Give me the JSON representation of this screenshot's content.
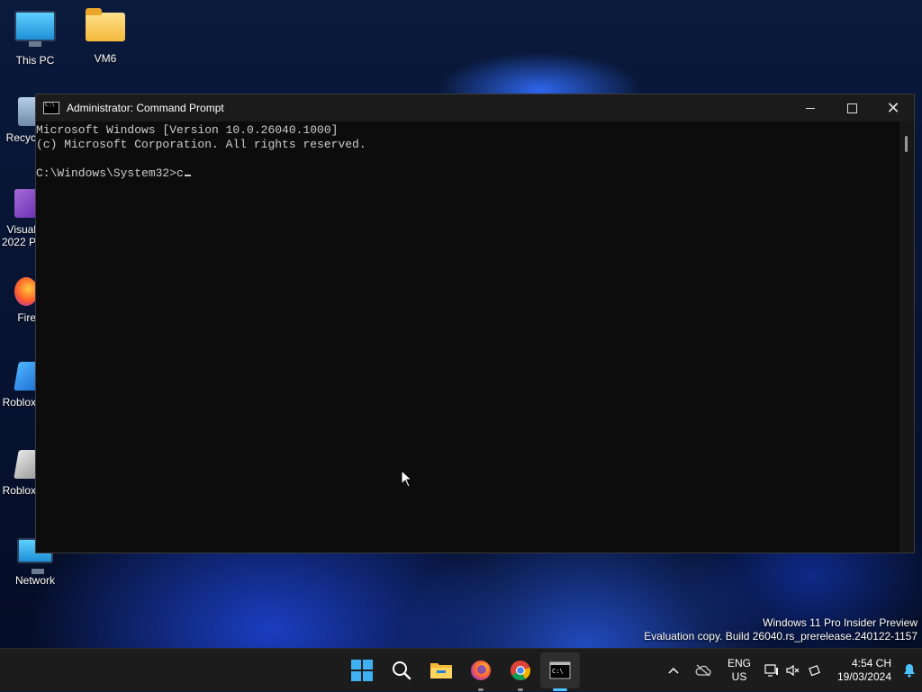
{
  "desktop": {
    "icons": [
      {
        "name": "This PC",
        "icon": "monitor-icon"
      },
      {
        "name": "VM6",
        "icon": "folder-icon"
      },
      {
        "name": "Recyc",
        "icon": "recycle-bin-icon"
      },
      {
        "name": "Visual",
        "name2": "2022 P",
        "icon": "visual-studio-icon"
      },
      {
        "name": "Fire",
        "icon": "firefox-icon"
      },
      {
        "name": "Roblox",
        "icon": "roblox-icon"
      },
      {
        "name": "Roblox",
        "icon": "roblox-studio-icon"
      },
      {
        "name": "Network",
        "icon": "network-icon"
      }
    ]
  },
  "window": {
    "title": "Administrator: Command Prompt",
    "icon": "cmd-icon",
    "console_lines": [
      "Microsoft Windows [Version 10.0.26040.1000]",
      "(c) Microsoft Corporation. All rights reserved.",
      "",
      "C:\\Windows\\System32>c"
    ]
  },
  "watermark": {
    "line1": "Windows 11 Pro Insider Preview",
    "line2": "Evaluation copy. Build 26040.rs_prerelease.240122-1157"
  },
  "taskbar": {
    "apps": [
      {
        "icon": "windows-start-icon"
      },
      {
        "icon": "search-icon"
      },
      {
        "icon": "file-explorer-icon"
      },
      {
        "icon": "firefox-icon"
      },
      {
        "icon": "chrome-icon"
      },
      {
        "icon": "command-prompt-icon",
        "active": true
      }
    ],
    "lang_line1": "ENG",
    "lang_line2": "US",
    "time": "4:54 CH",
    "date": "19/03/2024"
  },
  "colors": {
    "console_bg": "#0c0c0c",
    "console_text": "#cccccc",
    "accent": "#4cc2ff"
  }
}
